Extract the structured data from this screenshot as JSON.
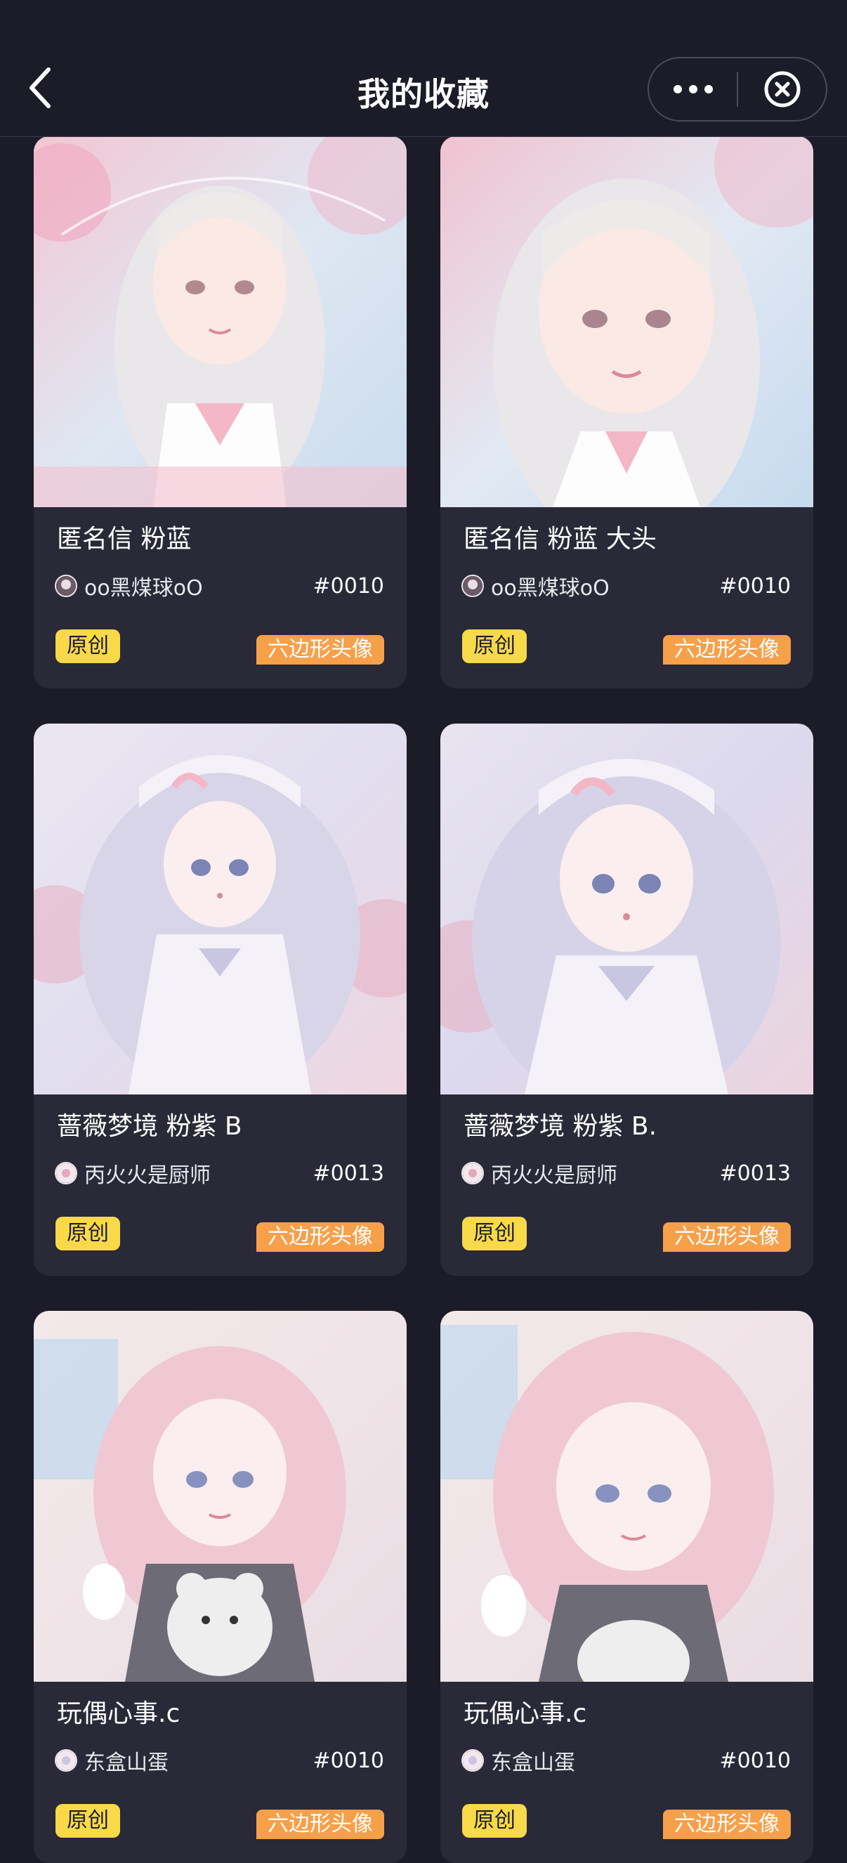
{
  "header": {
    "title": "我的收藏",
    "back_icon": "chevron-left-icon",
    "more_icon": "more-dots-icon",
    "close_icon": "close-circle-icon"
  },
  "colors": {
    "background": "#1c1c28",
    "card": "#292937",
    "badge_original": "#f8d94a",
    "badge_type": "#f7a04a"
  },
  "cards": [
    {
      "title": "匿名信 粉蓝",
      "author": "oo黑煤球oO",
      "number": "#0010",
      "badge_original": "原创",
      "badge_type": "六边形头像",
      "image_theme": "pink-blue"
    },
    {
      "title": "匿名信 粉蓝 大头",
      "author": "oo黑煤球oO",
      "number": "#0010",
      "badge_original": "原创",
      "badge_type": "六边形头像",
      "image_theme": "pink-blue"
    },
    {
      "title": "蔷薇梦境 粉紫 B",
      "author": "丙火火是厨师",
      "number": "#0013",
      "badge_original": "原创",
      "badge_type": "六边形头像",
      "image_theme": "lavender"
    },
    {
      "title": "蔷薇梦境 粉紫 B.",
      "author": "丙火火是厨师",
      "number": "#0013",
      "badge_original": "原创",
      "badge_type": "六边形头像",
      "image_theme": "lavender"
    },
    {
      "title": "玩偶心事.c",
      "author": "东盒山蛋",
      "number": "#0010",
      "badge_original": "原创",
      "badge_type": "六边形头像",
      "image_theme": "pink"
    },
    {
      "title": "玩偶心事.c",
      "author": "东盒山蛋",
      "number": "#0010",
      "badge_original": "原创",
      "badge_type": "六边形头像",
      "image_theme": "pink"
    }
  ]
}
